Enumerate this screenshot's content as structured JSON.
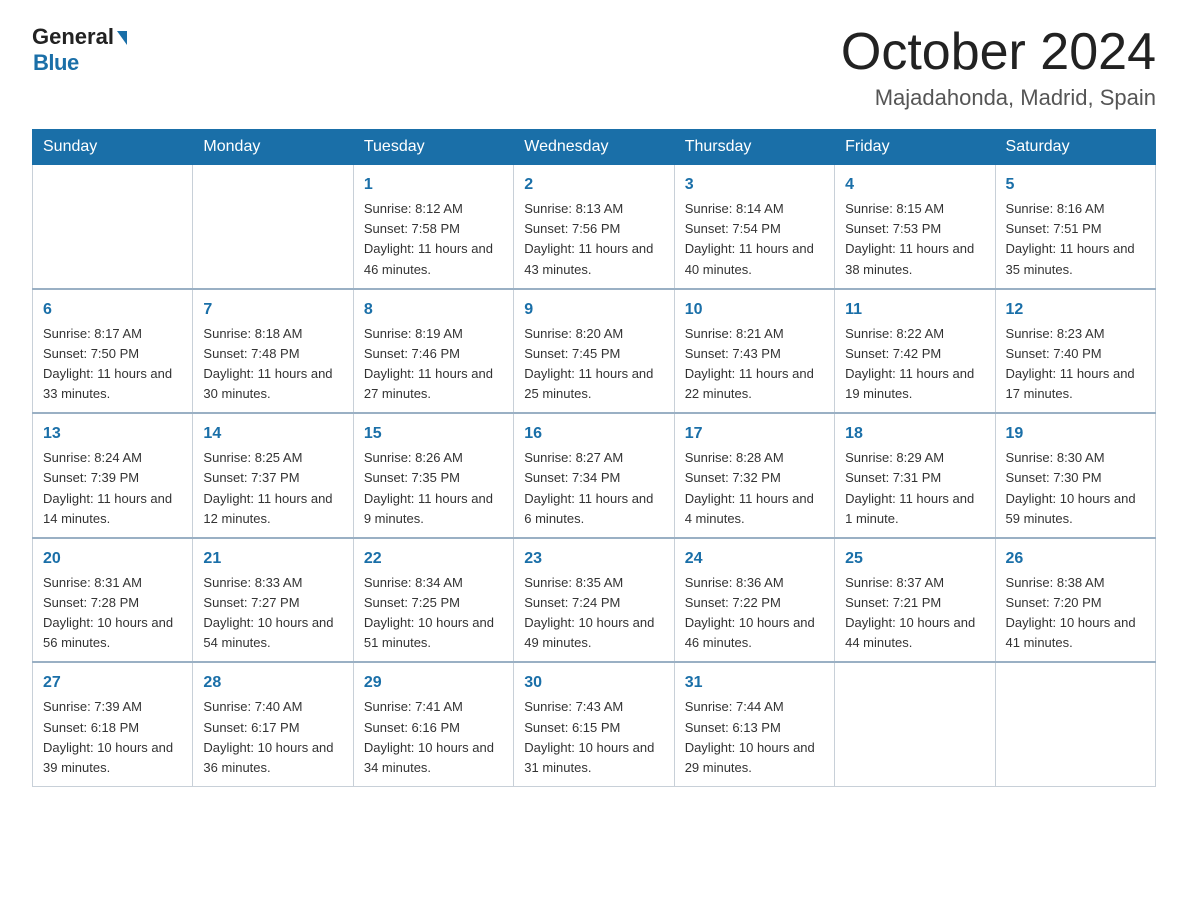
{
  "logo": {
    "general": "General",
    "blue": "Blue"
  },
  "title": "October 2024",
  "subtitle": "Majadahonda, Madrid, Spain",
  "days_of_week": [
    "Sunday",
    "Monday",
    "Tuesday",
    "Wednesday",
    "Thursday",
    "Friday",
    "Saturday"
  ],
  "weeks": [
    [
      {
        "day": "",
        "info": ""
      },
      {
        "day": "",
        "info": ""
      },
      {
        "day": "1",
        "info": "Sunrise: 8:12 AM\nSunset: 7:58 PM\nDaylight: 11 hours\nand 46 minutes."
      },
      {
        "day": "2",
        "info": "Sunrise: 8:13 AM\nSunset: 7:56 PM\nDaylight: 11 hours\nand 43 minutes."
      },
      {
        "day": "3",
        "info": "Sunrise: 8:14 AM\nSunset: 7:54 PM\nDaylight: 11 hours\nand 40 minutes."
      },
      {
        "day": "4",
        "info": "Sunrise: 8:15 AM\nSunset: 7:53 PM\nDaylight: 11 hours\nand 38 minutes."
      },
      {
        "day": "5",
        "info": "Sunrise: 8:16 AM\nSunset: 7:51 PM\nDaylight: 11 hours\nand 35 minutes."
      }
    ],
    [
      {
        "day": "6",
        "info": "Sunrise: 8:17 AM\nSunset: 7:50 PM\nDaylight: 11 hours\nand 33 minutes."
      },
      {
        "day": "7",
        "info": "Sunrise: 8:18 AM\nSunset: 7:48 PM\nDaylight: 11 hours\nand 30 minutes."
      },
      {
        "day": "8",
        "info": "Sunrise: 8:19 AM\nSunset: 7:46 PM\nDaylight: 11 hours\nand 27 minutes."
      },
      {
        "day": "9",
        "info": "Sunrise: 8:20 AM\nSunset: 7:45 PM\nDaylight: 11 hours\nand 25 minutes."
      },
      {
        "day": "10",
        "info": "Sunrise: 8:21 AM\nSunset: 7:43 PM\nDaylight: 11 hours\nand 22 minutes."
      },
      {
        "day": "11",
        "info": "Sunrise: 8:22 AM\nSunset: 7:42 PM\nDaylight: 11 hours\nand 19 minutes."
      },
      {
        "day": "12",
        "info": "Sunrise: 8:23 AM\nSunset: 7:40 PM\nDaylight: 11 hours\nand 17 minutes."
      }
    ],
    [
      {
        "day": "13",
        "info": "Sunrise: 8:24 AM\nSunset: 7:39 PM\nDaylight: 11 hours\nand 14 minutes."
      },
      {
        "day": "14",
        "info": "Sunrise: 8:25 AM\nSunset: 7:37 PM\nDaylight: 11 hours\nand 12 minutes."
      },
      {
        "day": "15",
        "info": "Sunrise: 8:26 AM\nSunset: 7:35 PM\nDaylight: 11 hours\nand 9 minutes."
      },
      {
        "day": "16",
        "info": "Sunrise: 8:27 AM\nSunset: 7:34 PM\nDaylight: 11 hours\nand 6 minutes."
      },
      {
        "day": "17",
        "info": "Sunrise: 8:28 AM\nSunset: 7:32 PM\nDaylight: 11 hours\nand 4 minutes."
      },
      {
        "day": "18",
        "info": "Sunrise: 8:29 AM\nSunset: 7:31 PM\nDaylight: 11 hours\nand 1 minute."
      },
      {
        "day": "19",
        "info": "Sunrise: 8:30 AM\nSunset: 7:30 PM\nDaylight: 10 hours\nand 59 minutes."
      }
    ],
    [
      {
        "day": "20",
        "info": "Sunrise: 8:31 AM\nSunset: 7:28 PM\nDaylight: 10 hours\nand 56 minutes."
      },
      {
        "day": "21",
        "info": "Sunrise: 8:33 AM\nSunset: 7:27 PM\nDaylight: 10 hours\nand 54 minutes."
      },
      {
        "day": "22",
        "info": "Sunrise: 8:34 AM\nSunset: 7:25 PM\nDaylight: 10 hours\nand 51 minutes."
      },
      {
        "day": "23",
        "info": "Sunrise: 8:35 AM\nSunset: 7:24 PM\nDaylight: 10 hours\nand 49 minutes."
      },
      {
        "day": "24",
        "info": "Sunrise: 8:36 AM\nSunset: 7:22 PM\nDaylight: 10 hours\nand 46 minutes."
      },
      {
        "day": "25",
        "info": "Sunrise: 8:37 AM\nSunset: 7:21 PM\nDaylight: 10 hours\nand 44 minutes."
      },
      {
        "day": "26",
        "info": "Sunrise: 8:38 AM\nSunset: 7:20 PM\nDaylight: 10 hours\nand 41 minutes."
      }
    ],
    [
      {
        "day": "27",
        "info": "Sunrise: 7:39 AM\nSunset: 6:18 PM\nDaylight: 10 hours\nand 39 minutes."
      },
      {
        "day": "28",
        "info": "Sunrise: 7:40 AM\nSunset: 6:17 PM\nDaylight: 10 hours\nand 36 minutes."
      },
      {
        "day": "29",
        "info": "Sunrise: 7:41 AM\nSunset: 6:16 PM\nDaylight: 10 hours\nand 34 minutes."
      },
      {
        "day": "30",
        "info": "Sunrise: 7:43 AM\nSunset: 6:15 PM\nDaylight: 10 hours\nand 31 minutes."
      },
      {
        "day": "31",
        "info": "Sunrise: 7:44 AM\nSunset: 6:13 PM\nDaylight: 10 hours\nand 29 minutes."
      },
      {
        "day": "",
        "info": ""
      },
      {
        "day": "",
        "info": ""
      }
    ]
  ]
}
